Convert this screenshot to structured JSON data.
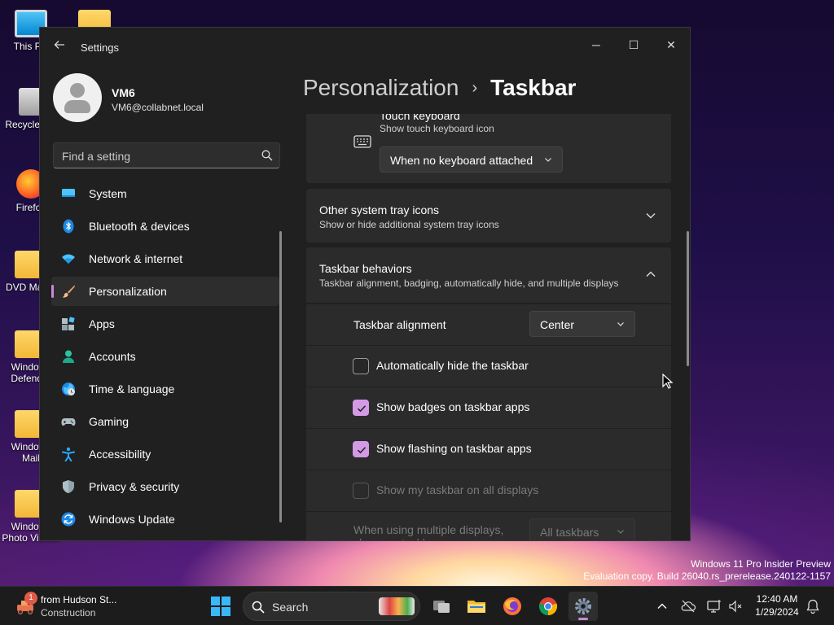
{
  "desktop": {
    "icons": [
      {
        "label": "This PC",
        "kind": "pc"
      },
      {
        "label": "Recycle Bin",
        "kind": "bin"
      },
      {
        "label": "Firefox",
        "kind": "firefox"
      },
      {
        "label": "DVD Maker",
        "kind": "folder"
      },
      {
        "label": "Windows Defender",
        "kind": "folder"
      },
      {
        "label": "Windows Mail",
        "kind": "folder"
      },
      {
        "label": "Windows Photo Viewer",
        "kind": "folder"
      }
    ],
    "watermark_line1": "Windows 11 Pro Insider Preview",
    "watermark_line2": "Evaluation copy. Build 26040.rs_prerelease.240122-1157"
  },
  "window": {
    "title": "Settings",
    "controls": {
      "minimize": "─",
      "maximize": "☐",
      "close": "✕"
    }
  },
  "profile": {
    "name": "VM6",
    "email": "VM6@collabnet.local"
  },
  "search": {
    "placeholder": "Find a setting"
  },
  "nav": {
    "items": [
      {
        "label": "System",
        "icon": "system-icon"
      },
      {
        "label": "Bluetooth & devices",
        "icon": "bluetooth-icon"
      },
      {
        "label": "Network & internet",
        "icon": "wifi-icon"
      },
      {
        "label": "Personalization",
        "icon": "brush-icon",
        "active": true
      },
      {
        "label": "Apps",
        "icon": "apps-icon"
      },
      {
        "label": "Accounts",
        "icon": "accounts-icon"
      },
      {
        "label": "Time & language",
        "icon": "globe-icon"
      },
      {
        "label": "Gaming",
        "icon": "gamepad-icon"
      },
      {
        "label": "Accessibility",
        "icon": "accessibility-icon"
      },
      {
        "label": "Privacy & security",
        "icon": "shield-icon"
      },
      {
        "label": "Windows Update",
        "icon": "update-icon"
      }
    ]
  },
  "breadcrumb": {
    "parent": "Personalization",
    "separator": "›",
    "current": "Taskbar"
  },
  "touch_keyboard": {
    "title": "Touch keyboard",
    "subtitle": "Show touch keyboard icon",
    "dropdown_value": "When no keyboard attached"
  },
  "other_tray": {
    "title": "Other system tray icons",
    "subtitle": "Show or hide additional system tray icons",
    "expanded": false
  },
  "behaviors": {
    "title": "Taskbar behaviors",
    "subtitle": "Taskbar alignment, badging, automatically hide, and multiple displays",
    "expanded": true,
    "alignment_label": "Taskbar alignment",
    "alignment_value": "Center",
    "options": [
      {
        "label": "Automatically hide the taskbar",
        "checked": false,
        "disabled": false
      },
      {
        "label": "Show badges on taskbar apps",
        "checked": true,
        "disabled": false
      },
      {
        "label": "Show flashing on taskbar apps",
        "checked": true,
        "disabled": false
      },
      {
        "label": "Show my taskbar on all displays",
        "checked": false,
        "disabled": true
      }
    ],
    "multi_display_label": "When using multiple displays, show my taskbar apps on",
    "multi_display_value": "All taskbars"
  },
  "taskbar": {
    "news_title": "from Hudson St...",
    "news_sub": "Construction",
    "news_badge": "1",
    "search_label": "Search",
    "apps": [
      "task-view-icon",
      "file-explorer-icon",
      "firefox-icon",
      "chrome-icon",
      "settings-icon"
    ],
    "time": "12:40 AM",
    "date": "1/29/2024"
  },
  "colors": {
    "accent": "#d49ae6",
    "window_bg": "#202020",
    "card_bg": "#2b2b2b"
  }
}
